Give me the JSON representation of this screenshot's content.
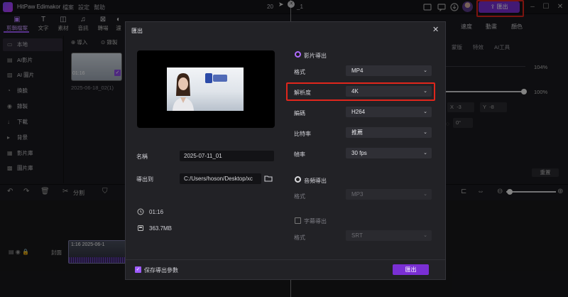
{
  "app": {
    "name": "HitPaw Edimakor",
    "menus": [
      "檔案",
      "設定",
      "幫助"
    ],
    "project_title": "20",
    "project_suffix": "_1",
    "export_label": "匯出"
  },
  "toolbar": {
    "tools": [
      {
        "label": "剪輯檔案",
        "icon": "layers-icon"
      },
      {
        "label": "文字",
        "icon": "text-icon"
      },
      {
        "label": "素材",
        "icon": "materials-icon"
      },
      {
        "label": "音訊",
        "icon": "music-icon"
      },
      {
        "label": "轉場",
        "icon": "transition-icon"
      },
      {
        "label": "濾",
        "icon": "filter-icon"
      }
    ]
  },
  "sidebar": {
    "items": [
      {
        "label": "本地",
        "icon": "folder-icon"
      },
      {
        "label": "AI影片",
        "icon": "ai-video-icon"
      },
      {
        "label": "AI 圖片",
        "icon": "ai-image-icon"
      },
      {
        "label": "換臉",
        "icon": "face-swap-icon"
      },
      {
        "label": "錄製",
        "icon": "record-icon"
      },
      {
        "label": "下載",
        "icon": "download-icon"
      },
      {
        "label": "背景",
        "icon": "background-icon"
      },
      {
        "label": "影片庫",
        "icon": "video-library-icon"
      },
      {
        "label": "圖片庫",
        "icon": "image-library-icon"
      }
    ]
  },
  "media": {
    "import_label": "導入",
    "record_label": "錄製",
    "thumb_time": "01:16",
    "file_name": "2025-06-18_02(1)"
  },
  "right_panel": {
    "tabs": [
      "速度",
      "動畫",
      "顏色"
    ],
    "subtabs": [
      "蒙版",
      "特效",
      "AI工具"
    ],
    "percent_1": "104%",
    "percent_2": "100%",
    "x_label": "X",
    "x_value": "-3",
    "y_label": "Y",
    "y_value": "-8",
    "rotation": "0°",
    "reset_label": "重置"
  },
  "timeline": {
    "split_label": "分割",
    "track_label": "封面",
    "clip_text": "1:16  2025-06-1"
  },
  "dialog": {
    "title": "匯出",
    "name_label": "名稱",
    "name_value": "2025-07-11_01",
    "export_to_label": "導出到",
    "export_path": "C:/Users/hoson/Desktop/xc",
    "duration": "01:16",
    "file_size": "363.7MB",
    "video_export_label": "影片導出",
    "video_export_on": true,
    "format_label": "格式",
    "format_value": "MP4",
    "resolution_label": "解析度",
    "resolution_value": "4K",
    "codec_label": "編碼",
    "codec_value": "H264",
    "bitrate_label": "比特率",
    "bitrate_value": "推薦",
    "framerate_label": "幀率",
    "framerate_value": "30  fps",
    "audio_export_label": "音頻導出",
    "audio_export_on": false,
    "audio_format_label": "格式",
    "audio_format_value": "MP3",
    "subtitle_export_label": "字幕導出",
    "subtitle_export_on": false,
    "subtitle_format_label": "格式",
    "subtitle_format_value": "SRT",
    "save_params_label": "保存導出參數",
    "save_params_checked": true,
    "export_button": "匯出"
  },
  "colors": {
    "accent": "#7a2fd4",
    "highlight": "#e0261c",
    "radio_on": "#b06cff"
  }
}
